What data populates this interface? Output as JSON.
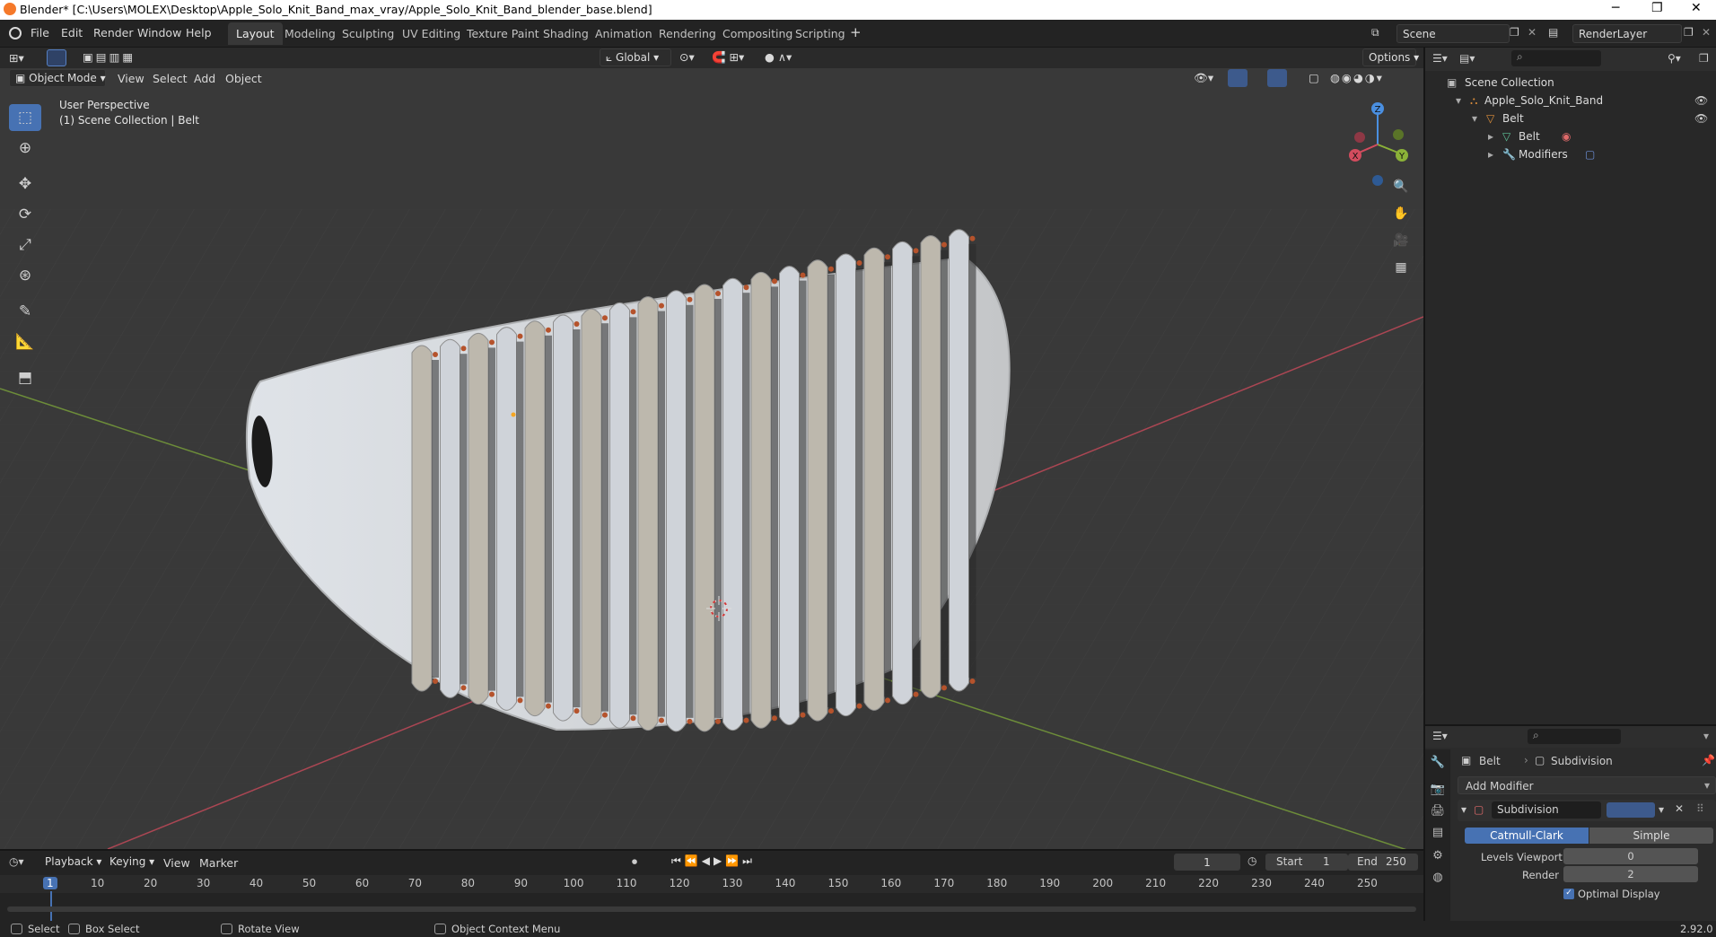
{
  "window": {
    "title": "Blender* [C:\\Users\\MOLEX\\Desktop\\Apple_Solo_Knit_Band_max_vray/Apple_Solo_Knit_Band_blender_base.blend]",
    "minimize": "─",
    "maximize": "❐",
    "close": "✕"
  },
  "menu": {
    "file": "File",
    "edit": "Edit",
    "render": "Render",
    "window": "Window",
    "help": "Help"
  },
  "workspace_tabs": [
    "Layout",
    "Modeling",
    "Sculpting",
    "UV Editing",
    "Texture Paint",
    "Shading",
    "Animation",
    "Rendering",
    "Compositing",
    "Scripting"
  ],
  "add_workspace": "+",
  "scene": {
    "scene_name": "Scene",
    "render_layer": "RenderLayer"
  },
  "viewport_header": {
    "mode": "Object Mode",
    "view": "View",
    "select": "Select",
    "add": "Add",
    "object": "Object",
    "orientation": "Global",
    "options": "Options"
  },
  "viewport": {
    "perspective_label": "User Perspective",
    "collection_label": "(1) Scene Collection | Belt"
  },
  "gizmo": {
    "z": "Z",
    "y": "Y",
    "x": "X"
  },
  "outliner": {
    "root": "Scene Collection",
    "items": [
      {
        "label": "Apple_Solo_Knit_Band"
      },
      {
        "label": "Belt"
      },
      {
        "label": "Belt"
      },
      {
        "label": "Modifiers"
      }
    ]
  },
  "properties": {
    "breadcrumb_object": "Belt",
    "breadcrumb_modifier": "Subdivision",
    "add_modifier": "Add Modifier",
    "modifier_name": "Subdivision",
    "algorithm_options": [
      "Catmull-Clark",
      "Simple"
    ],
    "selected_algorithm": "Catmull-Clark",
    "levels_viewport_label": "Levels Viewport",
    "levels_viewport_value": "0",
    "render_label": "Render",
    "render_value": "2",
    "optimal_display_label": "Optimal Display"
  },
  "timeline": {
    "playback": "Playback",
    "keying": "Keying",
    "view": "View",
    "marker": "Marker",
    "current_frame": "1",
    "start_label": "Start",
    "start_value": "1",
    "end_label": "End",
    "end_value": "250",
    "ruler_ticks": [
      "1",
      "10",
      "20",
      "30",
      "40",
      "50",
      "60",
      "70",
      "80",
      "90",
      "100",
      "110",
      "120",
      "130",
      "140",
      "150",
      "160",
      "170",
      "180",
      "190",
      "200",
      "210",
      "220",
      "230",
      "240",
      "250"
    ]
  },
  "statusbar": {
    "select": "Select",
    "box_select": "Box Select",
    "rotate_view": "Rotate View",
    "context_menu": "Object Context Menu",
    "version": "2.92.0"
  },
  "colors": {
    "accent": "#4772b3",
    "viewport_bg": "#393939",
    "axis_x": "#d24c5e",
    "axis_y": "#8bb238",
    "axis_z": "#4a8fe0"
  }
}
